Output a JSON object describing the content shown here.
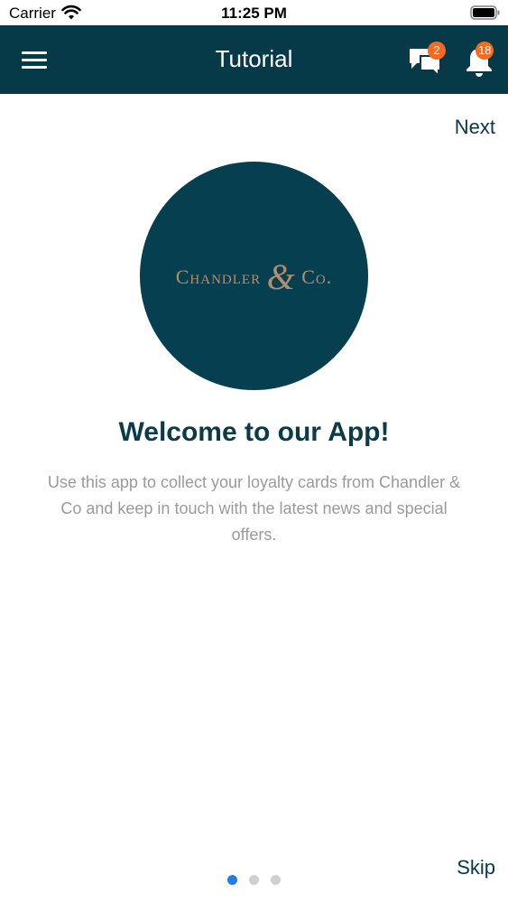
{
  "status_bar": {
    "carrier": "Carrier",
    "time": "11:25 PM",
    "icons": [
      "wifi-icon",
      "battery-icon"
    ]
  },
  "nav": {
    "title": "Tutorial",
    "menu_icon": "hamburger-menu-icon",
    "chat_icon": "chat-bubbles-icon",
    "chat_badge": "2",
    "bell_icon": "bell-icon",
    "bell_badge": "18"
  },
  "tutorial": {
    "next_label": "Next",
    "logo": {
      "brand_main": "Chandler",
      "ampersand": "&",
      "brand_suffix": "Co."
    },
    "heading": "Welcome to our App!",
    "body": "Use this app to collect your loyalty cards from Chandler & Co and keep in touch with the latest news and special offers.",
    "pagination": {
      "current": 1,
      "total": 3
    },
    "skip_label": "Skip"
  },
  "colors": {
    "nav_background": "#063a48",
    "logo_circle": "#063f50",
    "logo_text": "#b58d6e",
    "badge": "#f26b21",
    "active_dot": "#1f7ce8",
    "inactive_dot": "#cfcfcf",
    "heading": "#0a3c48",
    "body_text": "#9a9a9a"
  }
}
